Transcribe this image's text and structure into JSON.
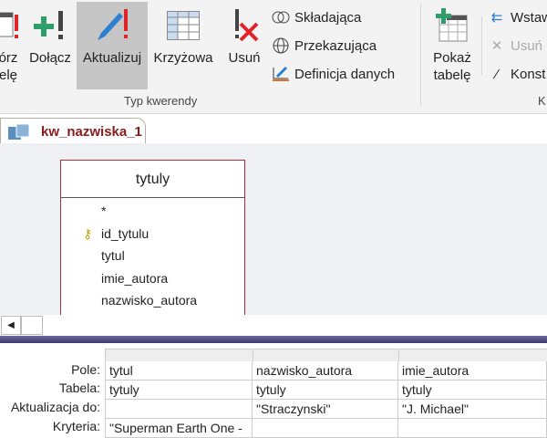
{
  "ribbon": {
    "make_table": {
      "line1": "órz",
      "line2": "elę"
    },
    "append": "Dołącz",
    "update": "Aktualizuj",
    "crosstab": "Krzyżowa",
    "delete": "Usuń",
    "union": "Składająca",
    "passthrough": "Przekazująca",
    "data_definition": "Definicja danych",
    "group_label": "Typ kwerendy",
    "show_table": {
      "line1": "Pokaż",
      "line2": "tabelę"
    },
    "insert": "Wstaw",
    "remove": "Usuń",
    "builder": "Konst",
    "group2_label": "K",
    "colors": {
      "accent_red": "#e0242a",
      "green": "#2e9e6a",
      "active_bg": "#c6c6c6"
    }
  },
  "tab": {
    "label": "kw_nazwiska_1"
  },
  "table": {
    "name": "tytuly",
    "fields": [
      "*",
      "id_tytulu",
      "tytul",
      "imie_autora",
      "nazwisko_autora"
    ],
    "primary_key": "id_tytulu"
  },
  "grid": {
    "row_labels": [
      "Pole:",
      "Tabela:",
      "Aktualizacja do:",
      "Kryteria:"
    ],
    "columns": [
      {
        "field": "tytul",
        "table": "tytuly",
        "update_to": "",
        "criteria": "\"Superman Earth One -"
      },
      {
        "field": "nazwisko_autora",
        "table": "tytuly",
        "update_to": "\"Straczynski\"",
        "criteria": ""
      },
      {
        "field": "imie_autora",
        "table": "tytuly",
        "update_to": "\"J. Michael\"",
        "criteria": ""
      }
    ]
  }
}
